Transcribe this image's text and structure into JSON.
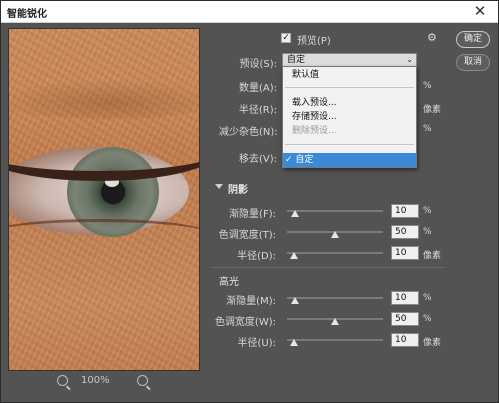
{
  "window": {
    "title": "智能锐化",
    "close_glyph": "✕"
  },
  "buttons": {
    "ok": "确定",
    "cancel": "取消"
  },
  "preview_checkbox": {
    "label": "预览(P)",
    "checked": true
  },
  "gear_icon": "gear-icon",
  "preset": {
    "label": "预设(S):",
    "value": "自定",
    "menu": [
      {
        "label": "默认值",
        "disabled": false
      },
      {
        "label": "载入预设...",
        "disabled": false
      },
      {
        "label": "存储预设...",
        "disabled": false
      },
      {
        "label": "删除预设...",
        "disabled": true
      },
      {
        "label": "✓ 自定",
        "selected": true
      }
    ]
  },
  "controls": {
    "amount_label": "数量(A):",
    "radius_label": "半径(R):",
    "reduce_noise_label": "减少杂色(N):",
    "remove_label": "移去(V):",
    "units_visible": [
      "%",
      "像素",
      "%"
    ]
  },
  "shadows": {
    "title": "阴影",
    "rows": [
      {
        "label": "渐隐量(F):",
        "value": "10",
        "unit": "%",
        "fraction": 0.08
      },
      {
        "label": "色调宽度(T):",
        "value": "50",
        "unit": "%",
        "fraction": 0.5
      },
      {
        "label": "半径(D):",
        "value": "10",
        "unit": "像素",
        "fraction": 0.07
      }
    ]
  },
  "highlights": {
    "title": "高光",
    "rows": [
      {
        "label": "渐隐量(M):",
        "value": "10",
        "unit": "%",
        "fraction": 0.08
      },
      {
        "label": "色调宽度(W):",
        "value": "50",
        "unit": "%",
        "fraction": 0.5
      },
      {
        "label": "半径(U):",
        "value": "10",
        "unit": "像素",
        "fraction": 0.07
      }
    ]
  },
  "zoom": {
    "text": "100%"
  }
}
